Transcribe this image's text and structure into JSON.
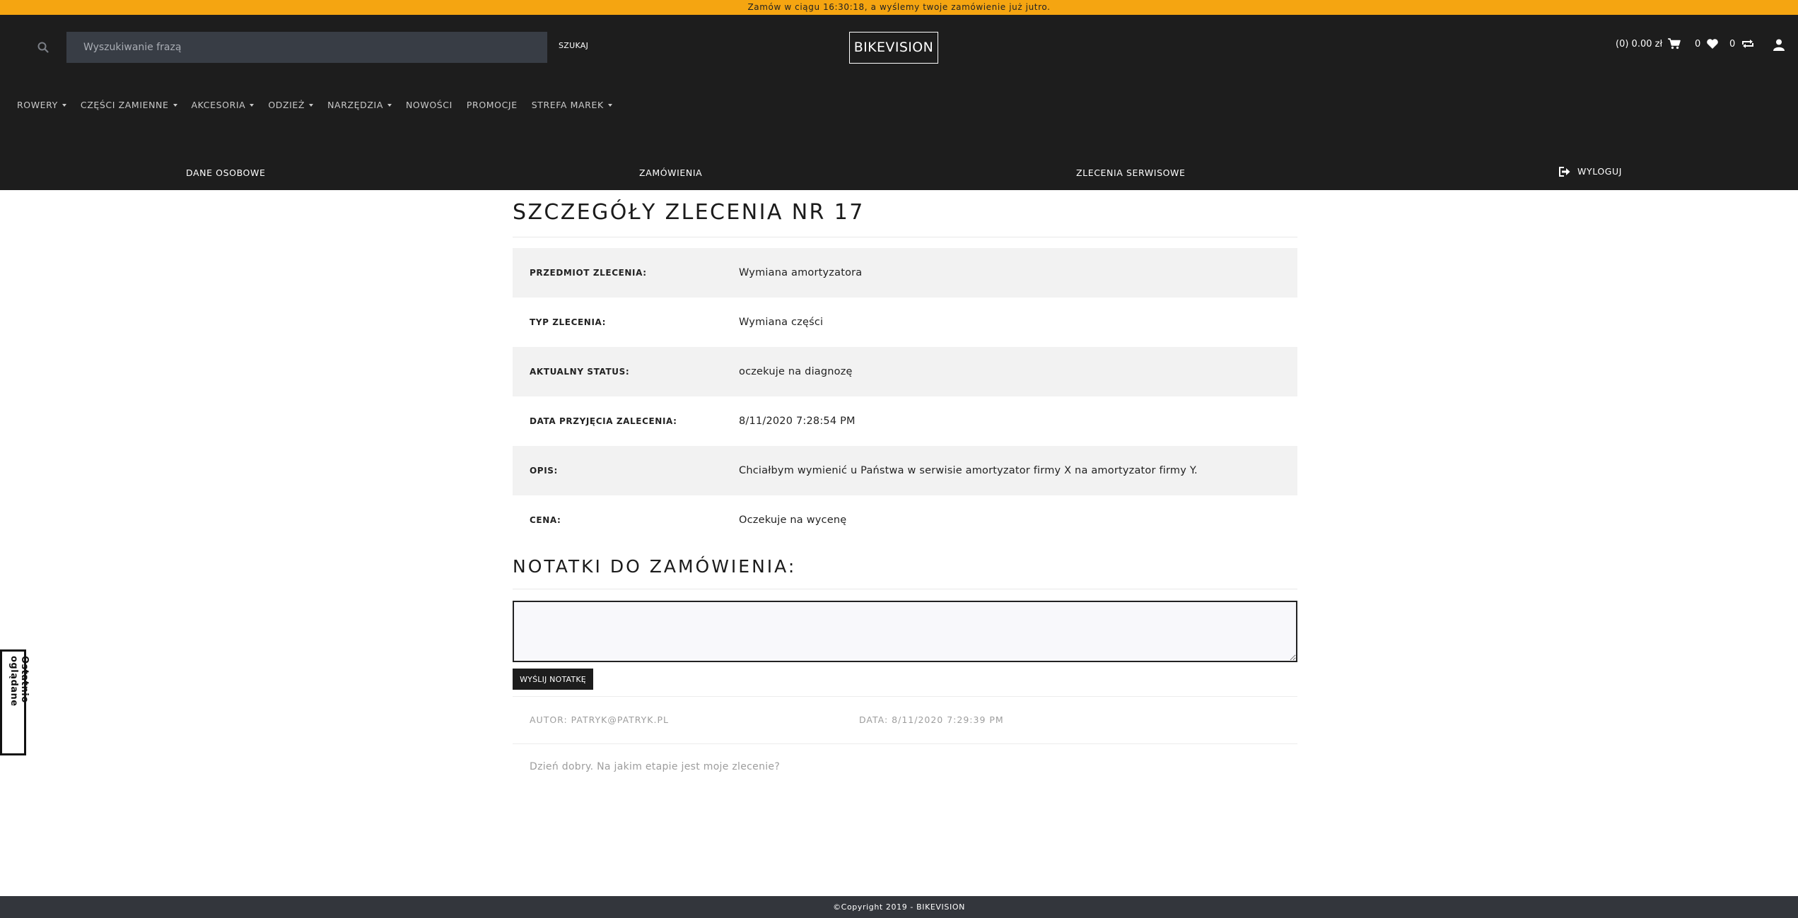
{
  "topbar": {
    "text": "Zamów w ciągu 16:30:18, a wyślemy twoje zamówienie już jutro."
  },
  "header": {
    "search_placeholder": "Wyszukiwanie frazą",
    "search_button": "SZUKAJ",
    "logo": "BIKEVISION",
    "cart": "(0) 0.00 zł",
    "wishlist_count": "0",
    "compare_count": "0"
  },
  "nav": [
    {
      "label": "ROWERY",
      "dropdown": true
    },
    {
      "label": "CZĘŚCI ZAMIENNE",
      "dropdown": true
    },
    {
      "label": "AKCESORIA",
      "dropdown": true
    },
    {
      "label": "ODZIEŻ",
      "dropdown": true
    },
    {
      "label": "NARZĘDZIA",
      "dropdown": true
    },
    {
      "label": "NOWOŚCI",
      "dropdown": false
    },
    {
      "label": "PROMOCJE",
      "dropdown": false
    },
    {
      "label": "STREFA MAREK",
      "dropdown": true
    }
  ],
  "account_nav": {
    "personal": "DANE OSOBOWE",
    "orders": "ZAMÓWIENIA",
    "service": "ZLECENIA SERWISOWE",
    "logout": "WYLOGUJ"
  },
  "page": {
    "title": "SZCZEGÓŁY ZLECENIA NR 17",
    "details": [
      {
        "label": "PRZEDMIOT ZLECENIA:",
        "value": "Wymiana amortyzatora"
      },
      {
        "label": "TYP ZLECENIA:",
        "value": "Wymiana części"
      },
      {
        "label": "AKTUALNY STATUS:",
        "value": "oczekuje na diagnozę"
      },
      {
        "label": "DATA PRZYJĘCIA ZALECENIA:",
        "value": "8/11/2020 7:28:54 PM"
      },
      {
        "label": "OPIS:",
        "value": "Chciałbym wymienić u Państwa w serwisie amortyzator firmy X na amortyzator firmy Y."
      },
      {
        "label": "CENA:",
        "value": "Oczekuje na wycenę"
      }
    ],
    "notes_title": "NOTATKI DO ZAMÓWIENIA:",
    "send_button": "WYŚLIJ NOTATKĘ",
    "note": {
      "author": "AUTOR: PATRYK@PATRYK.PL",
      "date": "DATA: 8/11/2020 7:29:39 PM",
      "text": "Dzień dobry. Na jakim etapie jest moje zlecenie?"
    }
  },
  "recent_tab": "Ostatnio oglądane",
  "footer": "©Copyright 2019 - BIKEVISION",
  "colors": {
    "accent": "#f5a511",
    "header_bg": "#1d1d1d",
    "footer_bg": "#33363c",
    "row_shade": "#f2f2f2"
  }
}
